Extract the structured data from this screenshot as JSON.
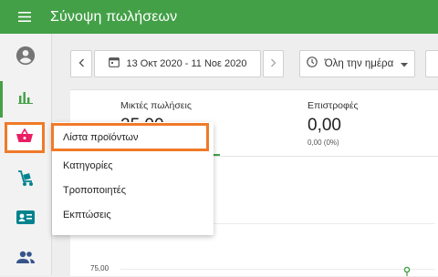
{
  "header": {
    "title": "Σύνοψη πωλήσεων"
  },
  "sidebar": {
    "items": [
      {
        "name": "account",
        "icon": "account-circle-icon"
      },
      {
        "name": "reports",
        "icon": "bar-chart-icon"
      },
      {
        "name": "items",
        "icon": "basket-icon"
      },
      {
        "name": "inventory",
        "icon": "dolly-icon"
      },
      {
        "name": "customers",
        "icon": "id-card-icon"
      },
      {
        "name": "employees",
        "icon": "people-icon"
      }
    ]
  },
  "toolbar": {
    "date_range": "13 Οκτ 2020 - 11 Νοε 2020",
    "time_filter": "Όλη την ημέρα"
  },
  "summary": {
    "gross_sales_label": "Μικτές πωλήσεις",
    "gross_sales_value": "25,00",
    "refunds_label": "Επιστροφές",
    "refunds_value": "0,00",
    "refunds_sub": "0,00 (0%)"
  },
  "chart": {
    "y_label": "75,00"
  },
  "dropdown": {
    "items": [
      {
        "label": "Λίστα προϊόντων"
      },
      {
        "label": "Κατηγορίες"
      },
      {
        "label": "Τροποποιητές"
      },
      {
        "label": "Εκπτώσεις"
      }
    ]
  },
  "colors": {
    "accent": "#43a047",
    "highlight": "#f07a28",
    "basket": "#e91e63",
    "sidebar_icon": "#00838f"
  }
}
